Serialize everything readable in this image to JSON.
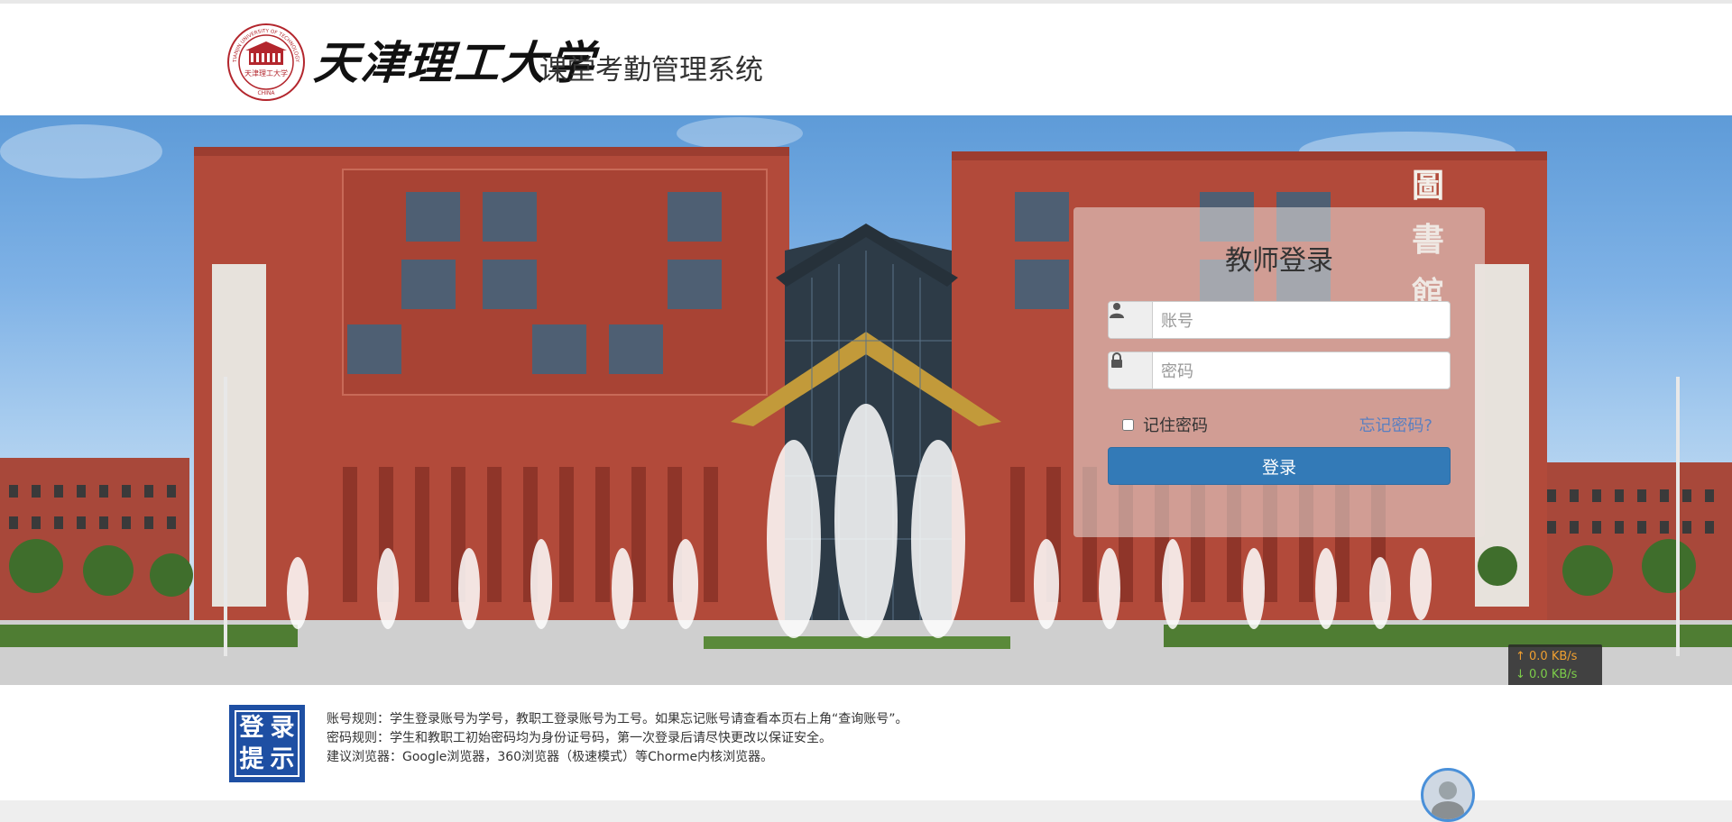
{
  "header": {
    "university_name": "天津理工大学",
    "system_title": "课堂考勤管理系统",
    "emblem_text_top": "TIANJIN UNIVERSITY OF TECHNOLOGY",
    "emblem_text_center": "天津理工大学",
    "emblem_text_bottom": "CHINA"
  },
  "login": {
    "title": "教师登录",
    "account_placeholder": "账号",
    "password_placeholder": "密码",
    "remember_label": "记住密码",
    "forgot_label": "忘记密码?",
    "submit_label": "登录"
  },
  "network_speed": {
    "upload": "↑ 0.0 KB/s",
    "download": "↓ 0.0 KB/s"
  },
  "footer": {
    "badge_chars": [
      "登",
      "录",
      "提",
      "示"
    ],
    "rules": [
      "账号规则：学生登录账号为学号，教职工登录账号为工号。如果忘记账号请查看本页右上角“查询账号”。",
      "密码规则：学生和教职工初始密码均为身份证号码，第一次登录后请尽快更改以保证安全。",
      "建议浏览器：Google浏览器，360浏览器（极速模式）等Chorme内核浏览器。"
    ]
  },
  "banner_sign_chars": [
    "圖",
    "書",
    "館"
  ],
  "colors": {
    "primary_button": "#337ab7",
    "badge_blue": "#1e4fa3",
    "link": "#5a7fc0"
  }
}
